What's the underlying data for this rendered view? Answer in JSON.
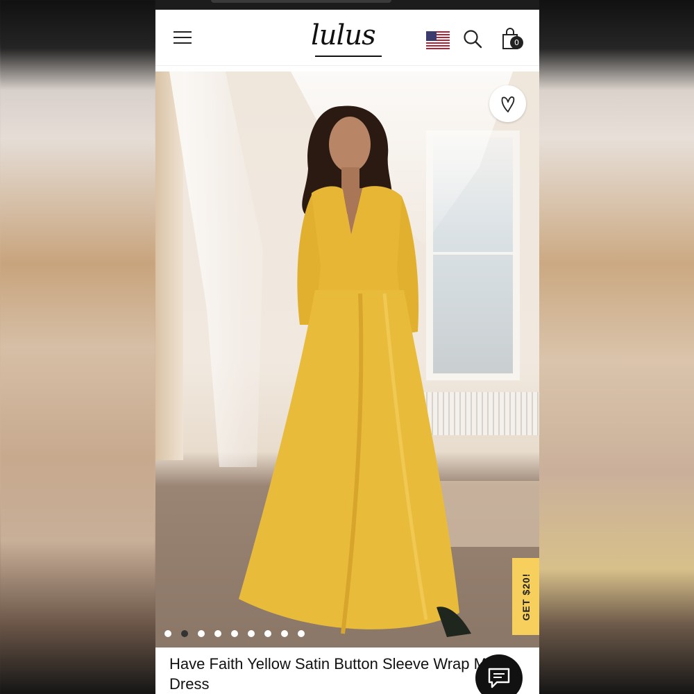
{
  "header": {
    "logo_text": "lulus",
    "cart_count": "0"
  },
  "icons": {
    "menu": "hamburger-icon",
    "flag": "us-flag-icon",
    "search": "search-icon",
    "cart": "shopping-bag-icon",
    "wishlist": "heart-icon",
    "chat": "chat-icon"
  },
  "product": {
    "title": "Have Faith Yellow Satin Button Sleeve Wrap Maxi Dress",
    "image_dots_total": 9,
    "image_dots_active": 2
  },
  "promo": {
    "label": "GET $20!"
  },
  "colors": {
    "promo_yellow": "#f6cf5c",
    "dress_yellow": "#e8b93a"
  }
}
